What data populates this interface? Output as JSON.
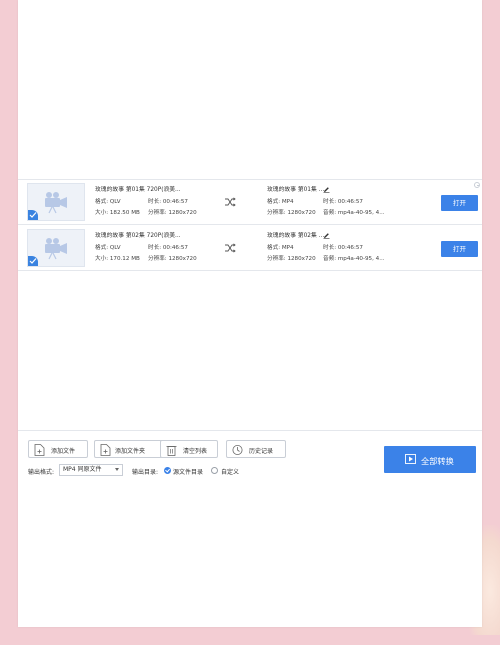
{
  "files": [
    {
      "name": "玫瑰的故事 第01集 720P(浪美...",
      "src_format": "格式: QLV",
      "src_duration": "时长: 00:46:57",
      "src_size": "大小: 182.50 MB",
      "src_resolution": "分辨率: 1280x720",
      "out_name": "玫瑰的故事 第01集 ...",
      "out_format": "格式: MP4",
      "out_duration": "时长: 00:46:57",
      "out_resolution": "分辨率: 1280x720",
      "out_audio": "音频: mp4a-40-95, 4...",
      "open_label": "打开"
    },
    {
      "name": "玫瑰的故事 第02集 720P(浪美...",
      "src_format": "格式: QLV",
      "src_duration": "时长: 00:46:57",
      "src_size": "大小: 170.12 MB",
      "src_resolution": "分辨率: 1280x720",
      "out_name": "玫瑰的故事 第02集 ...",
      "out_format": "格式: MP4",
      "out_duration": "时长: 00:46:57",
      "out_resolution": "分辨率: 1280x720",
      "out_audio": "音频: mp4a-40-95, 4...",
      "open_label": "打开"
    }
  ],
  "toolbar": {
    "add_file": "添加文件",
    "add_folder": "添加文件夹",
    "clear_list": "清空列表",
    "history": "历史记录"
  },
  "output": {
    "format_label": "输出格式:",
    "format_value": "MP4 同原文件",
    "dir_label": "输出目录:",
    "dir_option_source": "源文件目录",
    "dir_option_custom": "自定义"
  },
  "convert_all_label": "全部转换",
  "colors": {
    "accent": "#3b82e8",
    "background": "#f3cdd3"
  }
}
